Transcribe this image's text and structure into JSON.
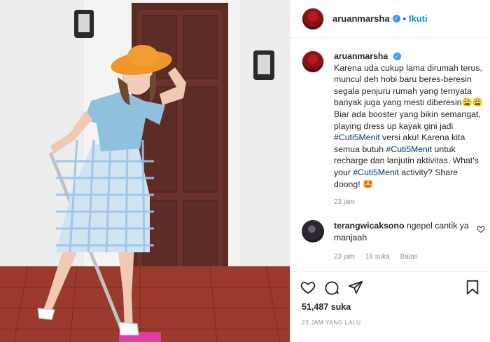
{
  "post": {
    "username": "aruanmarsha",
    "verified_icon": "verified-badge-icon",
    "follow_label": "Ikuti",
    "caption_lines": [
      "Karena uda cukup lama dirumah terus,",
      "muncul deh hobi baru beres-beresin",
      "segala penjuru rumah yang ternyata",
      "banyak juga yang mesti diberesin😩😩",
      "Biar ada booster yang bikin semangat,",
      "playing dress up kayak gini jadi"
    ],
    "caption_tag1": "#Cuti5Menit",
    "caption_after_tag1": " versi aku! Karena kita",
    "caption_line_b": "semua butuh ",
    "caption_tag2": "#Cuti5Menit",
    "caption_after_tag2": " untuk",
    "caption_line_c": "recharge dan lanjutin aktivitas. What's",
    "caption_line_d_pre": "your ",
    "caption_tag3": "#Cuti5Menit",
    "caption_line_d_post": " activity? Share",
    "caption_line_e": "doong! 🤩",
    "caption_time": "23 jam"
  },
  "comment": {
    "username": "terangwicaksono",
    "text": " ngepel cantik ya manjaah",
    "time": "23 jam",
    "likes": "18 suka",
    "reply": "Balas"
  },
  "footer": {
    "likes": "51,487 suka",
    "time_ago": "23 JAM YANG LALU"
  },
  "colors": {
    "link": "#0095f6",
    "hashtag": "#00376b",
    "muted": "#8e8e8e"
  }
}
